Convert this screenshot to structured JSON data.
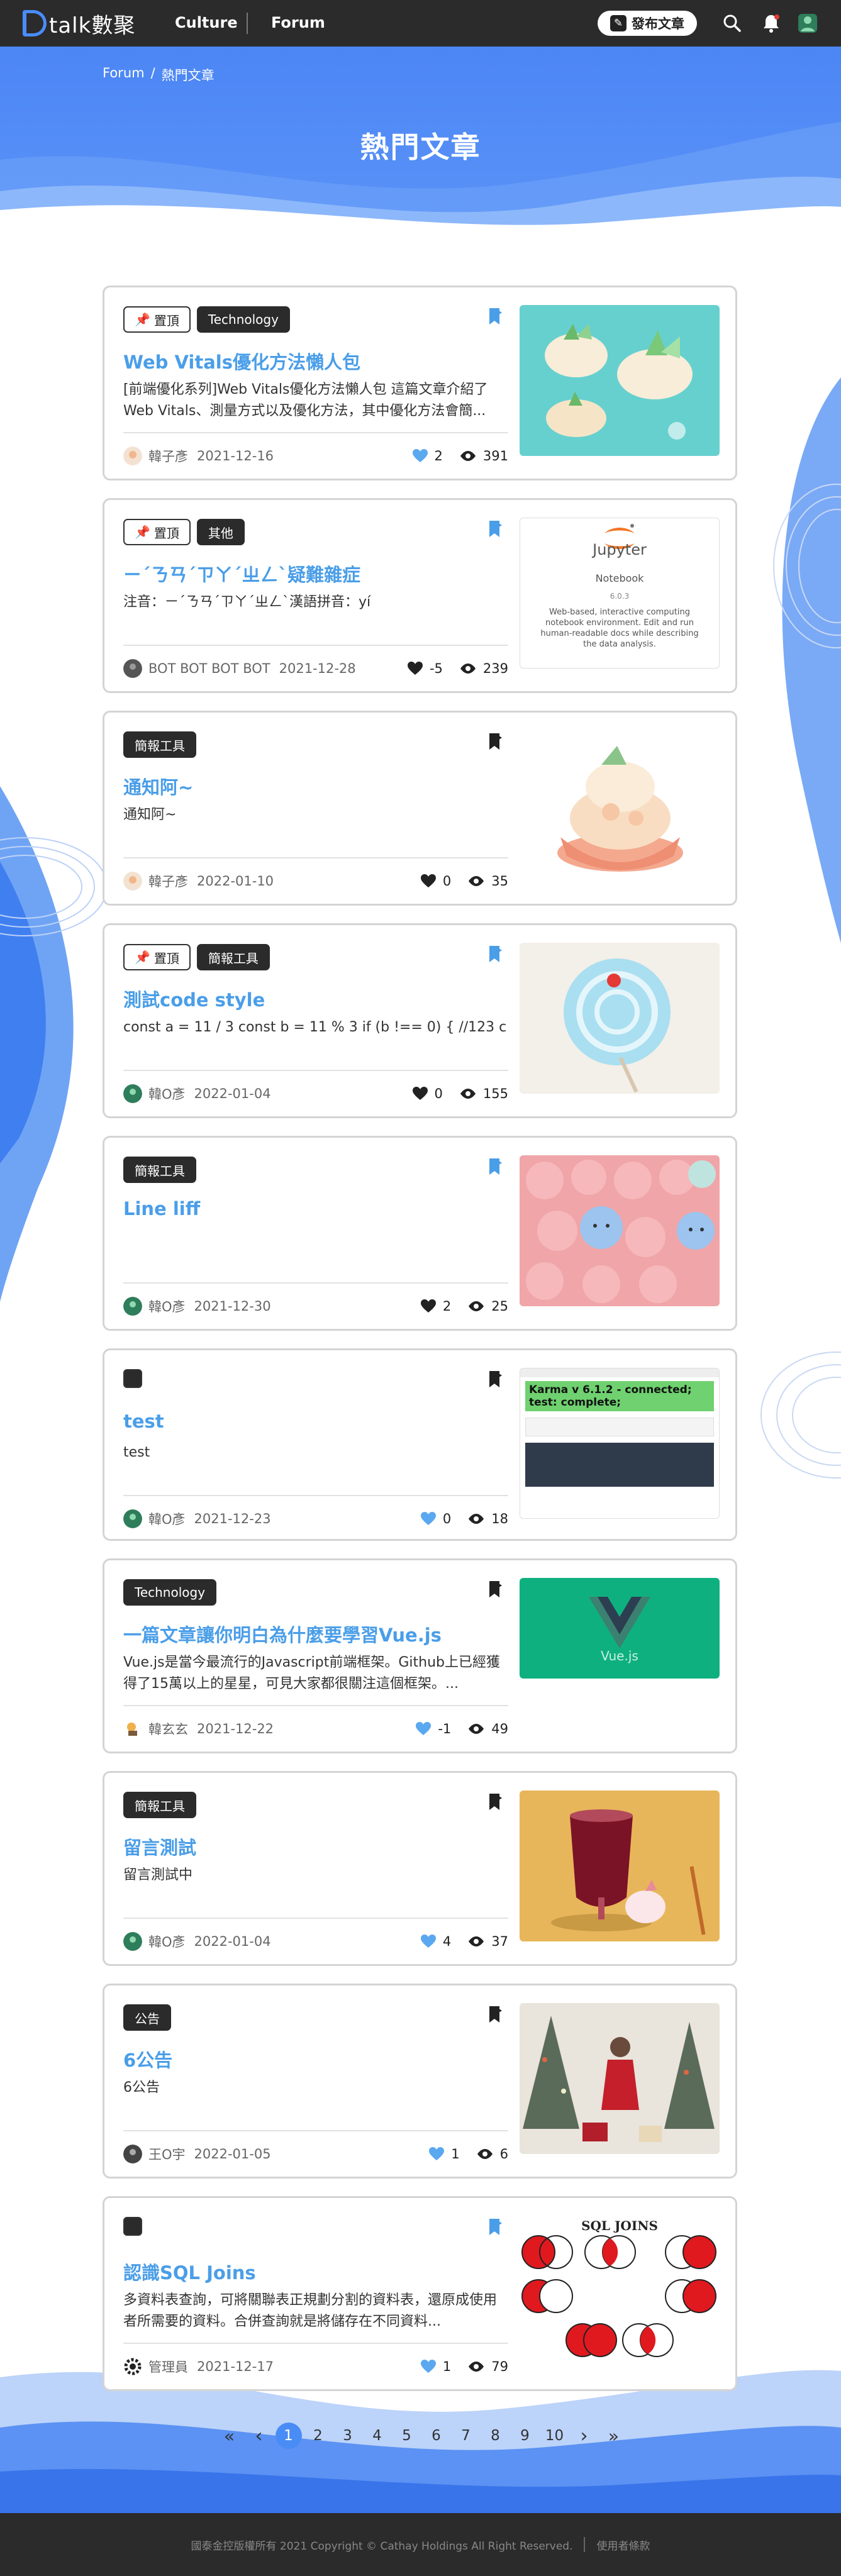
{
  "nav": {
    "logo_text": "talk",
    "logo_cn": "數聚",
    "links": [
      "Culture",
      "Forum"
    ],
    "publish_label": "發布文章",
    "icons": [
      "search-icon",
      "bell-icon",
      "user-avatar"
    ]
  },
  "breadcrumb": {
    "home": "Forum",
    "sep": "/",
    "current": "熱門文章"
  },
  "page_title": "熱門文章",
  "pin_label": "置頂",
  "posts": [
    {
      "tags": [
        "置頂",
        "Technology"
      ],
      "title": "Web Vitals優化方法懶人包",
      "summary": "[前端優化系列]Web Vitals優化方法懶人包 這篇文章介紹了Web Vitals、測量方式以及優化方法，其中優化方法會簡...",
      "author": "韓子彥",
      "date": "2021-12-16",
      "likes": "2",
      "views": "391",
      "liked": true,
      "bookmarked": true
    },
    {
      "tags": [
        "置頂",
        "其他"
      ],
      "title": "ㄧˊㄋㄢˊㄗㄚˊㄓㄥˋ疑難雜症",
      "summary": "注音：ㄧˊㄋㄢˊㄗㄚˊㄓㄥˋ漢語拼音：yí",
      "author": "BOT BOT BOT BOT",
      "date": "2021-12-28",
      "likes": "-5",
      "views": "239",
      "liked": false,
      "bookmarked": true,
      "thumb_title": "Jupyter",
      "thumb_sub": "Notebook",
      "thumb_ver": "6.0.3",
      "thumb_desc": "Web-based, interactive computing notebook environment. Edit and run human-readable docs while describing the data analysis."
    },
    {
      "tags": [
        "簡報工具"
      ],
      "title": "通知阿~",
      "summary": "通知阿~",
      "author": "韓子彥",
      "date": "2022-01-10",
      "likes": "0",
      "views": "35",
      "liked": false,
      "bookmarked": false
    },
    {
      "tags": [
        "置頂",
        "簡報工具"
      ],
      "title": "測試code style",
      "summary": "const a = 11 / 3 const b = 11 % 3 if (b !== 0) { //123 c",
      "author": "韓O彥",
      "date": "2022-01-04",
      "likes": "0",
      "views": "155",
      "liked": false,
      "bookmarked": true
    },
    {
      "tags": [
        "簡報工具"
      ],
      "title": "Line liff",
      "summary": "",
      "author": "韓O彥",
      "date": "2021-12-30",
      "likes": "2",
      "views": "25",
      "liked": false,
      "bookmarked": true
    },
    {
      "tags": [
        ""
      ],
      "title": "test",
      "summary": "test",
      "author": "韓O彥",
      "date": "2021-12-23",
      "likes": "0",
      "views": "18",
      "liked": true,
      "bookmarked": false,
      "thumb_header": "Karma v 6.1.2 - connected; test: complete;"
    },
    {
      "tags": [
        "Technology"
      ],
      "title": "一篇文章讓你明白為什麼要學習Vue.js",
      "summary": "Vue.js是當今最流行的Javascript前端框架。Github上已經獲得了15萬以上的星星，可見大家都很關注這個框架。...",
      "author": "韓玄玄",
      "date": "2021-12-22",
      "likes": "-1",
      "views": "49",
      "liked": true,
      "bookmarked": false,
      "thumb_caption": "Vue.js"
    },
    {
      "tags": [
        "簡報工具"
      ],
      "title": "留言測試",
      "summary": "留言測試中",
      "author": "韓O彥",
      "date": "2022-01-04",
      "likes": "4",
      "views": "37",
      "liked": true,
      "bookmarked": false
    },
    {
      "tags": [
        "公告"
      ],
      "title": "6公告",
      "summary": "6公告",
      "author": "王O宇",
      "date": "2022-01-05",
      "likes": "1",
      "views": "6",
      "liked": true,
      "bookmarked": false
    },
    {
      "tags": [
        ""
      ],
      "title": "認識SQL Joins",
      "summary": "多資料表查詢，可將關聯表正規劃分割的資料表，還原成使用者所需要的資料。合併查詢就是將儲存在不同資料...",
      "author": "管理員",
      "date": "2021-12-17",
      "likes": "1",
      "views": "79",
      "liked": true,
      "bookmarked": true,
      "thumb_title": "SQL JOINS"
    }
  ],
  "pagination": {
    "first": "«",
    "prev": "‹",
    "pages": [
      "1",
      "2",
      "3",
      "4",
      "5",
      "6",
      "7",
      "8",
      "9",
      "10"
    ],
    "current": "1",
    "next": "›",
    "last": "»"
  },
  "footer": {
    "copyright": "國泰金控版權所有 2021 Copyright © Cathay Holdings All Right Reserved.",
    "terms": "使用者條款"
  },
  "colors": {
    "nav_bg": "#2b2b2b",
    "banner": "#4c86f5",
    "link": "#4a9ee8",
    "like_active": "#5aa8f0"
  }
}
